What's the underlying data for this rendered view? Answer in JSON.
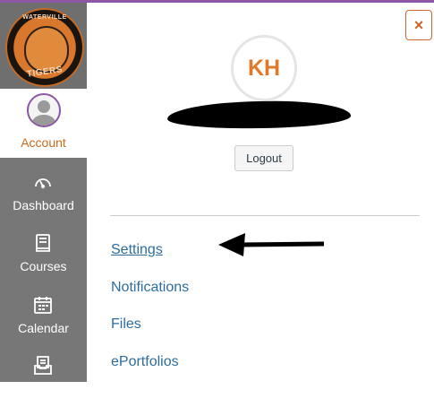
{
  "nav": {
    "logo": {
      "top_text": "WATERVILLE",
      "bottom_text": "TIGERS"
    },
    "account_label": "Account",
    "items": [
      {
        "label": "Dashboard",
        "icon": "dashboard-gauge-icon"
      },
      {
        "label": "Courses",
        "icon": "courses-book-icon"
      },
      {
        "label": "Calendar",
        "icon": "calendar-icon"
      },
      {
        "label": "",
        "icon": "inbox-icon"
      }
    ]
  },
  "tray": {
    "close_label": "×",
    "user_initials": "KH",
    "logout_label": "Logout",
    "links": [
      {
        "label": "Settings"
      },
      {
        "label": "Notifications"
      },
      {
        "label": "Files"
      },
      {
        "label": "ePortfolios"
      }
    ]
  },
  "colors": {
    "accent_purple": "#8b57a6",
    "accent_orange": "#d0652a",
    "nav_gray": "#777777",
    "link_blue": "#2d6d9e"
  }
}
